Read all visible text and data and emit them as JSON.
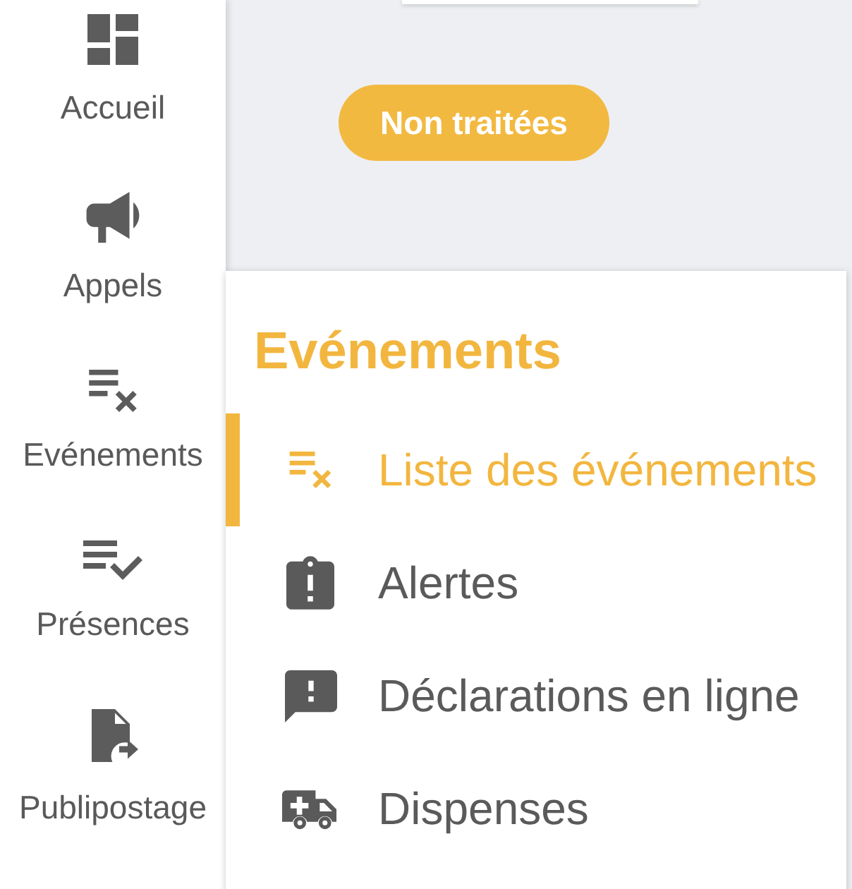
{
  "sidebar": {
    "items": [
      {
        "label": "Accueil"
      },
      {
        "label": "Appels"
      },
      {
        "label": "Evénements"
      },
      {
        "label": "Présences"
      },
      {
        "label": "Publipostage"
      }
    ]
  },
  "main": {
    "filter_chip": {
      "label": "Non traitées"
    }
  },
  "flyout": {
    "title": "Evénements",
    "items": [
      {
        "label": "Liste des événements",
        "selected": true
      },
      {
        "label": "Alertes",
        "selected": false
      },
      {
        "label": "Déclarations en ligne",
        "selected": false
      },
      {
        "label": "Dispenses",
        "selected": false
      }
    ]
  }
}
